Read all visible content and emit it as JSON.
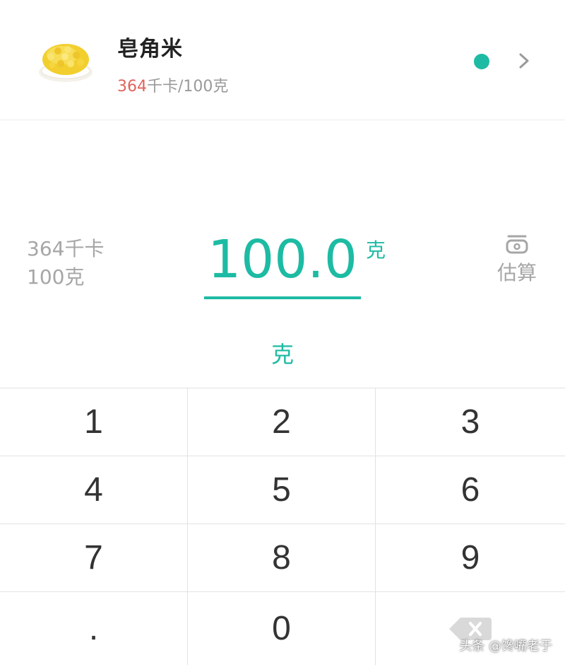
{
  "food": {
    "name": "皂角米",
    "calories_value": "364",
    "calories_unit": "千卡/100克"
  },
  "amount": {
    "info_kcal": "364千卡",
    "info_weight": "100克",
    "value": "100.0",
    "unit_small": "克",
    "unit_selected": "克"
  },
  "estimate": {
    "label": "估算",
    "icon": "scale-icon"
  },
  "keypad": {
    "keys": [
      "1",
      "2",
      "3",
      "4",
      "5",
      "6",
      "7",
      "8",
      "9",
      ".",
      "0"
    ],
    "delete_icon": "backspace-icon"
  },
  "watermark": "头条 @馋嘴老于",
  "colors": {
    "accent": "#1dbba3",
    "calorie_number": "#e0645c",
    "muted_text": "#a6a6a6"
  }
}
